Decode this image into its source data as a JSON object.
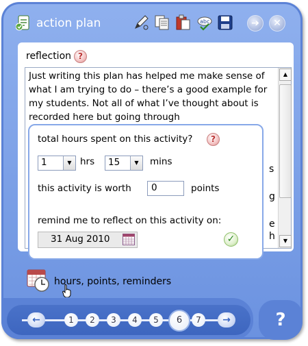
{
  "window": {
    "title": "action plan"
  },
  "toolbar": {
    "icons": [
      "draw-icon",
      "copy-icon",
      "paste-icon",
      "spellcheck-icon",
      "save-icon"
    ],
    "forward_symbol": "➔",
    "close_symbol": "✕"
  },
  "reflection": {
    "label": "reflection",
    "help_symbol": "?",
    "text": "Just writing this plan has helped me make sense of what I am trying to do – there’s a good example for my students. Not all of what I’ve thought about is recorded here but going through",
    "partial_chars": [
      "s",
      "g",
      "e",
      "h"
    ]
  },
  "popup": {
    "hours_label": "total hours spent on this activity?",
    "help_symbol": "?",
    "hours_value": "1",
    "hours_unit": "hrs",
    "mins_value": "15",
    "mins_unit": "mins",
    "worth_label": "this activity is worth",
    "points_value": "0",
    "points_unit": "points",
    "remind_label": "remind me to reflect on this activity on:",
    "date_value": "31 Aug 2010",
    "confirm_symbol": "✓"
  },
  "footer": {
    "hpr_label": "hours, points, reminders"
  },
  "nav": {
    "back_symbol": "←",
    "next_symbol": "→",
    "steps": [
      "1",
      "2",
      "3",
      "4",
      "5",
      "6",
      "7"
    ],
    "active_step": "6",
    "help_symbol": "?"
  },
  "colors": {
    "frame": "#5b82d6",
    "frame_light": "#8fb0ee",
    "nav_pill": "#3d66bf"
  }
}
